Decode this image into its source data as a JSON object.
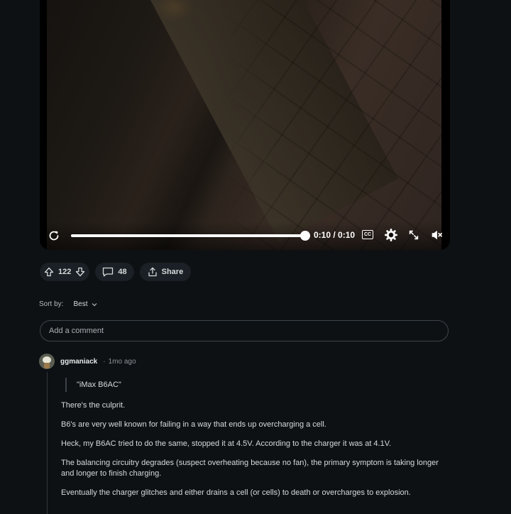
{
  "video": {
    "time": "0:10 / 0:10",
    "cc_label": "CC",
    "progress": 1.0
  },
  "actions": {
    "score": "122",
    "comments": "48",
    "share_label": "Share"
  },
  "sort": {
    "label": "Sort by:",
    "value": "Best"
  },
  "comment_input": {
    "placeholder": "Add a comment"
  },
  "comments": [
    {
      "user": "ggmaniack",
      "time": "1mo ago",
      "quote": "\"iMax B6AC\"",
      "paragraphs": [
        "There's the culprit.",
        "B6's are very well known for failing in a way that ends up overcharging a cell.",
        "Heck, my B6AC tried to do the same, stopped it at 4.5V. According to the charger it was at 4.1V.",
        "The balancing circuitry degrades (suspect overheating because no fan), the primary symptom is taking longer and longer to finish charging.",
        "Eventually the charger glitches and either drains a cell (or cells) to death or overcharges to explosion."
      ]
    }
  ],
  "colors": {
    "background": "#0e1113",
    "pill": "#1a2025",
    "text": "#d7dadc"
  }
}
